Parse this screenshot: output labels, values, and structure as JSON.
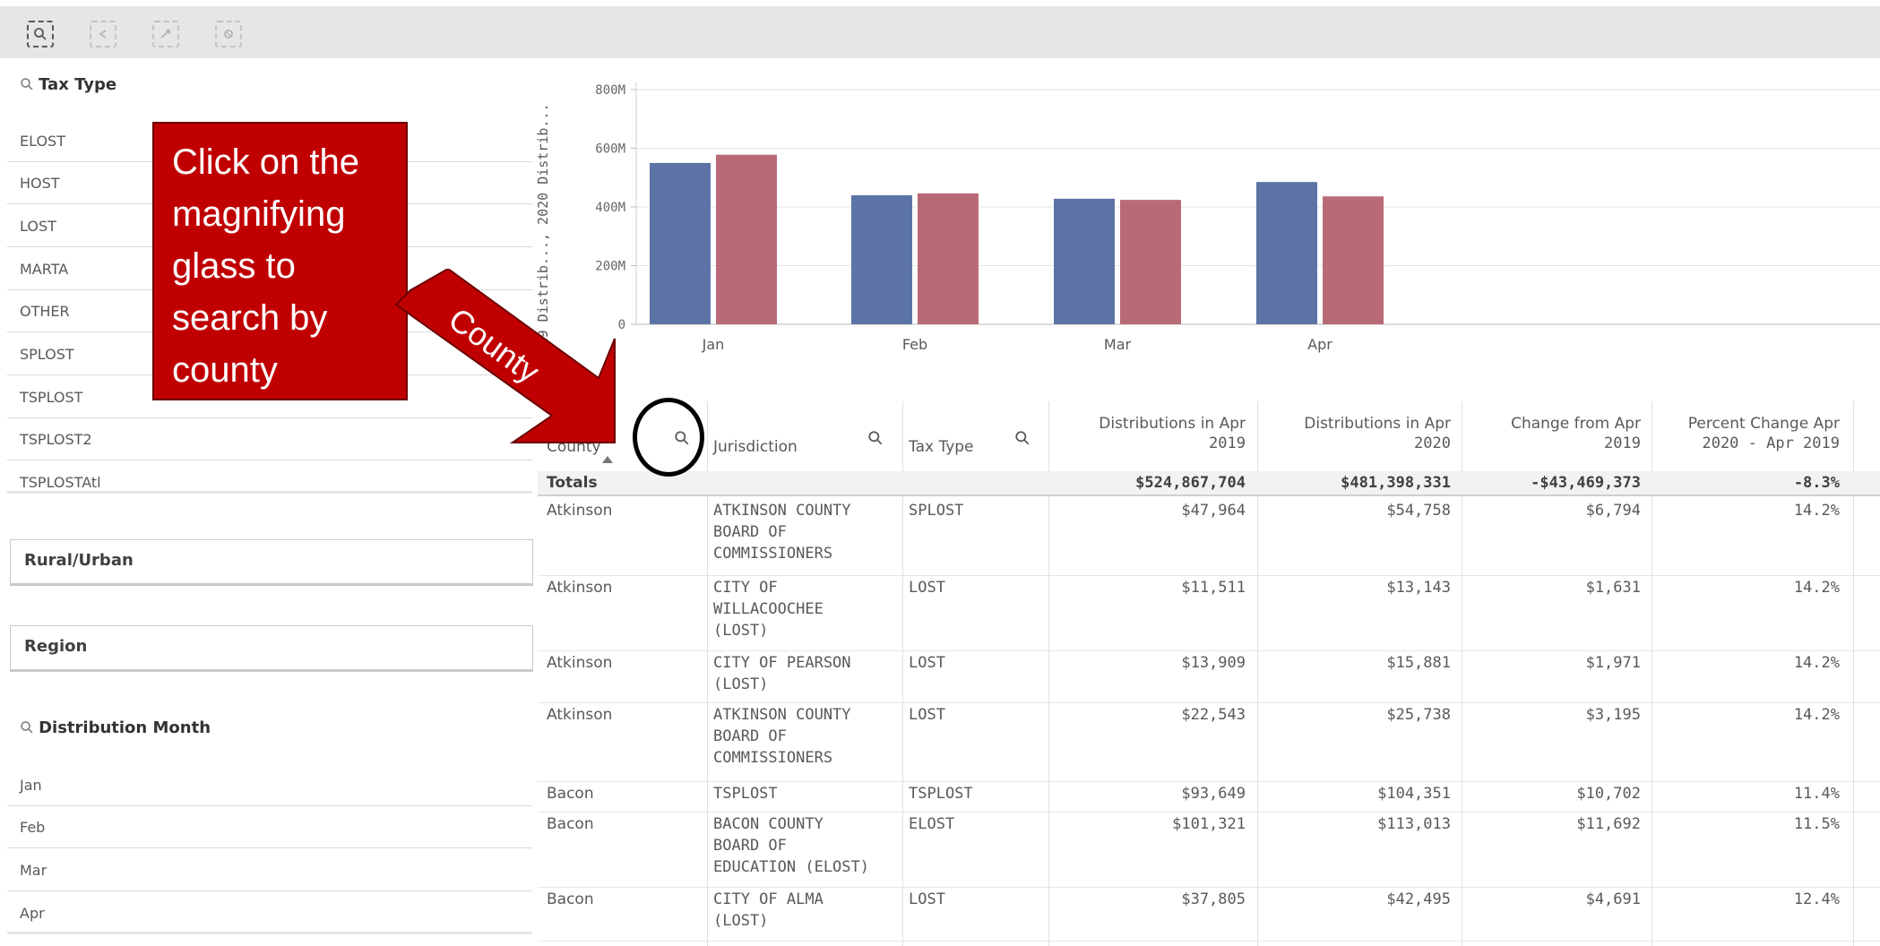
{
  "colors": {
    "bar_2019": "#5b74a5",
    "bar_2020": "#b86a76",
    "callout": "#c00000"
  },
  "toolbar": {
    "icons": [
      "smart-search-icon",
      "step-back-icon",
      "step-forward-icon",
      "clear-selections-icon"
    ]
  },
  "filters": {
    "tax_type": {
      "title": "Tax Type",
      "items": [
        "ELOST",
        "HOST",
        "LOST",
        "MARTA",
        "OTHER",
        "SPLOST",
        "TSPLOST",
        "TSPLOST2",
        "TSPLOSTAtl"
      ]
    },
    "rural_urban": {
      "title": "Rural/Urban"
    },
    "region": {
      "title": "Region"
    },
    "distribution_month": {
      "title": "Distribution Month",
      "items": [
        "Jan",
        "Feb",
        "Mar",
        "Apr"
      ]
    }
  },
  "annotation": {
    "callout_text": [
      "Click on the",
      "magnifying",
      "glass to",
      "search by",
      "county"
    ],
    "arrow_label": "County"
  },
  "chart_data": {
    "type": "bar",
    "categories": [
      "Jan",
      "Feb",
      "Mar",
      "Apr"
    ],
    "series": [
      {
        "values": [
          550,
          440,
          428,
          485
        ]
      },
      {
        "values": [
          578,
          446,
          424,
          436
        ]
      }
    ],
    "ylabel": "2019 Distrib..., 2020 Distrib...",
    "yticks": [
      "0",
      "200M",
      "400M",
      "600M",
      "800M"
    ],
    "ylim": [
      0,
      800
    ],
    "grid": true
  },
  "table": {
    "headers": {
      "county": "County",
      "jurisdiction": "Jurisdiction",
      "tax_type": "Tax Type",
      "dist_2019": [
        "Distributions in Apr",
        "2019"
      ],
      "dist_2020": [
        "Distributions in Apr",
        "2020"
      ],
      "change": [
        "Change from Apr",
        "2019"
      ],
      "pct": [
        "Percent Change Apr",
        "2020 - Apr 2019"
      ]
    },
    "totals": {
      "label": "Totals",
      "dist_2019": "$524,867,704",
      "dist_2020": "$481,398,331",
      "change": "-$43,469,373",
      "pct": "-8.3%"
    },
    "rows": [
      {
        "county": "Atkinson",
        "jurisdiction": [
          "ATKINSON COUNTY",
          "BOARD OF",
          "COMMISSIONERS"
        ],
        "tax_type": "SPLOST",
        "dist_2019": "$47,964",
        "dist_2020": "$54,758",
        "change": "$6,794",
        "pct": "14.2%"
      },
      {
        "county": "Atkinson",
        "jurisdiction": [
          "CITY OF",
          "WILLACOOCHEE",
          "(LOST)"
        ],
        "tax_type": "LOST",
        "dist_2019": "$11,511",
        "dist_2020": "$13,143",
        "change": "$1,631",
        "pct": "14.2%"
      },
      {
        "county": "Atkinson",
        "jurisdiction": [
          "CITY OF PEARSON",
          "(LOST)"
        ],
        "tax_type": "LOST",
        "dist_2019": "$13,909",
        "dist_2020": "$15,881",
        "change": "$1,971",
        "pct": "14.2%"
      },
      {
        "county": "Atkinson",
        "jurisdiction": [
          "ATKINSON COUNTY",
          "BOARD OF",
          "COMMISSIONERS"
        ],
        "tax_type": "LOST",
        "dist_2019": "$22,543",
        "dist_2020": "$25,738",
        "change": "$3,195",
        "pct": "14.2%"
      },
      {
        "county": "Bacon",
        "jurisdiction": [
          "TSPLOST"
        ],
        "tax_type": "TSPLOST",
        "dist_2019": "$93,649",
        "dist_2020": "$104,351",
        "change": "$10,702",
        "pct": "11.4%"
      },
      {
        "county": "Bacon",
        "jurisdiction": [
          "BACON COUNTY",
          "BOARD OF",
          "EDUCATION (ELOST)"
        ],
        "tax_type": "ELOST",
        "dist_2019": "$101,321",
        "dist_2020": "$113,013",
        "change": "$11,692",
        "pct": "11.5%"
      },
      {
        "county": "Bacon",
        "jurisdiction": [
          "CITY OF ALMA",
          "(LOST)"
        ],
        "tax_type": "LOST",
        "dist_2019": "$37,805",
        "dist_2020": "$42,495",
        "change": "$4,691",
        "pct": "12.4%"
      }
    ]
  }
}
